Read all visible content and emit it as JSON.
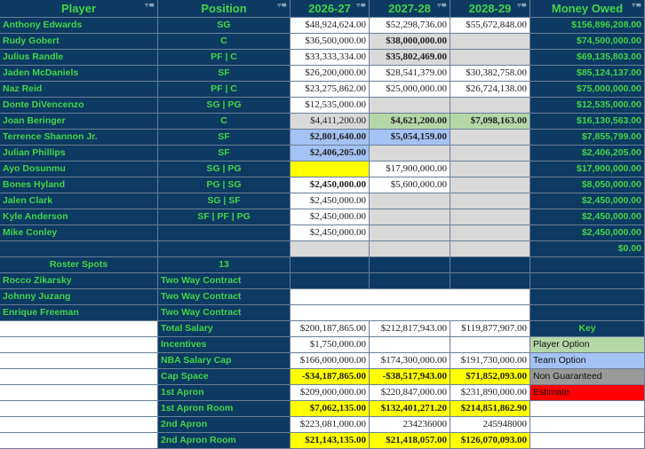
{
  "headers": [
    "Player",
    "Position",
    "2026-27",
    "2027-28",
    "2028-29",
    "Money Owed"
  ],
  "colors": {
    "navy": "#0d3a62",
    "green_text": "#44d447",
    "grey": "#d9d9d9",
    "player_option": "#b4d7a8",
    "team_option": "#a4c2f4",
    "non_guaranteed": "#999999",
    "estimate": "#ff0000",
    "highlight": "#ffff00"
  },
  "players": [
    {
      "name": "Anthony Edwards",
      "position": "SG",
      "y1": "$48,924,624.00",
      "y2": "$52,298,736.00",
      "y3": "$55,672,848.00",
      "owed": "$156,896,208.00"
    },
    {
      "name": "Rudy Gobert",
      "position": "C",
      "y1": "$36,500,000.00",
      "y2": "$38,000,000.00",
      "y3": "",
      "owed": "$74,500,000.00"
    },
    {
      "name": "Julius Randle",
      "position": "PF | C",
      "y1": "$33,333,334.00",
      "y2": "$35,802,469.00",
      "y3": "",
      "owed": "$69,135,803.00"
    },
    {
      "name": "Jaden McDaniels",
      "position": "SF",
      "y1": "$26,200,000.00",
      "y2": "$28,541,379.00",
      "y3": "$30,382,758.00",
      "owed": "$85,124,137.00"
    },
    {
      "name": "Naz Reid",
      "position": "PF | C",
      "y1": "$23,275,862.00",
      "y2": "$25,000,000.00",
      "y3": "$26,724,138.00",
      "owed": "$75,000,000.00"
    },
    {
      "name": "Donte DiVencenzo",
      "position": "SG | PG",
      "y1": "$12,535,000.00",
      "y2": "",
      "y3": "",
      "owed": "$12,535,000.00"
    },
    {
      "name": "Joan Beringer",
      "position": "C",
      "y1": "$4,411,200.00",
      "y2": "$4,621,200.00",
      "y3": "$7,098,163.00",
      "owed": "$16,130,563.00"
    },
    {
      "name": "Terrence Shannon Jr.",
      "position": "SF",
      "y1": "$2,801,640.00",
      "y2": "$5,054,159.00",
      "y3": "",
      "owed": "$7,855,799.00"
    },
    {
      "name": "Julian Phillips",
      "position": "SF",
      "y1": "$2,406,205.00",
      "y2": "",
      "y3": "",
      "owed": "$2,406,205.00"
    },
    {
      "name": "Ayo Dosunmu",
      "position": "SG | PG",
      "y1": "",
      "y2": "$17,900,000.00",
      "y3": "",
      "owed": "$17,900,000.00"
    },
    {
      "name": "Bones Hyland",
      "position": "PG | SG",
      "y1": "$2,450,000.00",
      "y2": "$5,600,000.00",
      "y3": "",
      "owed": "$8,050,000.00"
    },
    {
      "name": "Jalen Clark",
      "position": "SG | SF",
      "y1": "$2,450,000.00",
      "y2": "",
      "y3": "",
      "owed": "$2,450,000.00"
    },
    {
      "name": "Kyle Anderson",
      "position": "SF | PF | PG",
      "y1": "$2,450,000.00",
      "y2": "",
      "y3": "",
      "owed": "$2,450,000.00"
    },
    {
      "name": "Mike Conley",
      "position": "",
      "y1": "$2,450,000.00",
      "y2": "",
      "y3": "",
      "owed": "$2,450,000.00"
    },
    {
      "name": "",
      "position": "",
      "y1": "",
      "y2": "",
      "y3": "",
      "owed": "$0.00"
    }
  ],
  "roster": {
    "label": "Roster Spots",
    "value": "13"
  },
  "two_way": [
    {
      "name": "Rocco Zikarsky",
      "contract": "Two Way Contract"
    },
    {
      "name": "Johnny Juzang",
      "contract": "Two Way Contract"
    },
    {
      "name": "Enrique Freeman",
      "contract": "Two Way Contract"
    }
  ],
  "summary": [
    {
      "label": "Total Salary",
      "y1": "$200,187,865.00",
      "y2": "$212,817,943.00",
      "y3": "$119,877,907.00"
    },
    {
      "label": "Incentives",
      "y1": "$1,750,000.00",
      "y2": "",
      "y3": ""
    },
    {
      "label": "NBA Salary Cap",
      "y1": "$166,000,000.00",
      "y2": "$174,300,000.00",
      "y3": "$191,730,000.00"
    },
    {
      "label": "Cap Space",
      "y1": "-$34,187,865.00",
      "y2": "-$38,517,943.00",
      "y3": "$71,852,093.00"
    },
    {
      "label": "1st Apron",
      "y1": "$209,000,000.00",
      "y2": "$220,847,000.00",
      "y3": "$231,890,000.00"
    },
    {
      "label": "1st Apron Room",
      "y1": "$7,062,135.00",
      "y2": "$132,401,271.20",
      "y3": "$214,851,862.90"
    },
    {
      "label": "2nd Apron",
      "y1": "$223,081,000.00",
      "y2": "234236000",
      "y3": "245948000"
    },
    {
      "label": "2nd Apron Room",
      "y1": "$21,143,135.00",
      "y2": "$21,418,057.00",
      "y3": "$126,070,093.00"
    }
  ],
  "key": {
    "title": "Key",
    "items": [
      "Player Option",
      "Team Option",
      "Non Guaranteed",
      "Estimate"
    ]
  }
}
